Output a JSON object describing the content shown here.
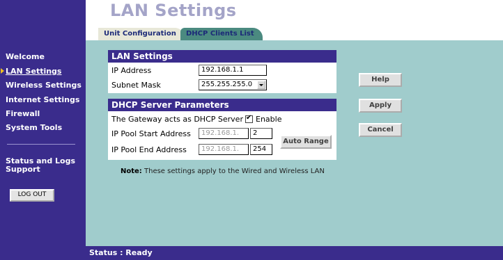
{
  "header": {
    "title": "LAN Settings"
  },
  "tabs": [
    {
      "label": "Unit Configuration",
      "active": true
    },
    {
      "label": "DHCP Clients List",
      "active": false
    }
  ],
  "sidebar": {
    "items": [
      {
        "label": "Welcome"
      },
      {
        "label": "LAN Settings",
        "active": true
      },
      {
        "label": "Wireless Settings"
      },
      {
        "label": "Internet Settings"
      },
      {
        "label": "Firewall"
      },
      {
        "label": "System Tools"
      },
      {
        "label": "Status and Logs"
      },
      {
        "label": "Support"
      }
    ],
    "logout_label": "LOG OUT"
  },
  "lan": {
    "header": "LAN Settings",
    "ip_label": "IP Address",
    "ip_value": "192.168.1.1",
    "subnet_label": "Subnet Mask",
    "subnet_value": "255.255.255.0"
  },
  "dhcp": {
    "header": "DHCP Server Parameters",
    "gateway_label": "The Gateway acts as DHCP Server",
    "enable_label": "Enable",
    "enable_checked": true,
    "start_label": "IP Pool Start Address",
    "start_prefix": "192.168.1.",
    "start_value": "2",
    "end_label": "IP Pool End Address",
    "end_prefix": "192.168.1.",
    "end_value": "254",
    "auto_range_label": "Auto Range"
  },
  "buttons": {
    "help": "Help",
    "apply": "Apply",
    "cancel": "Cancel"
  },
  "note": {
    "prefix": "Note:",
    "text": " These settings apply to the Wired and Wireless LAN"
  },
  "status": {
    "text": "Status : Ready"
  },
  "colors": {
    "sidebar": "#3a2c8c",
    "content": "#a0cccc",
    "title": "#a4a4c8",
    "arrow": "#f0c020"
  },
  "icons": {
    "active_marker": "triangle-right-icon",
    "checkbox": "checkmark-icon",
    "dropdown": "chevron-down-icon"
  }
}
